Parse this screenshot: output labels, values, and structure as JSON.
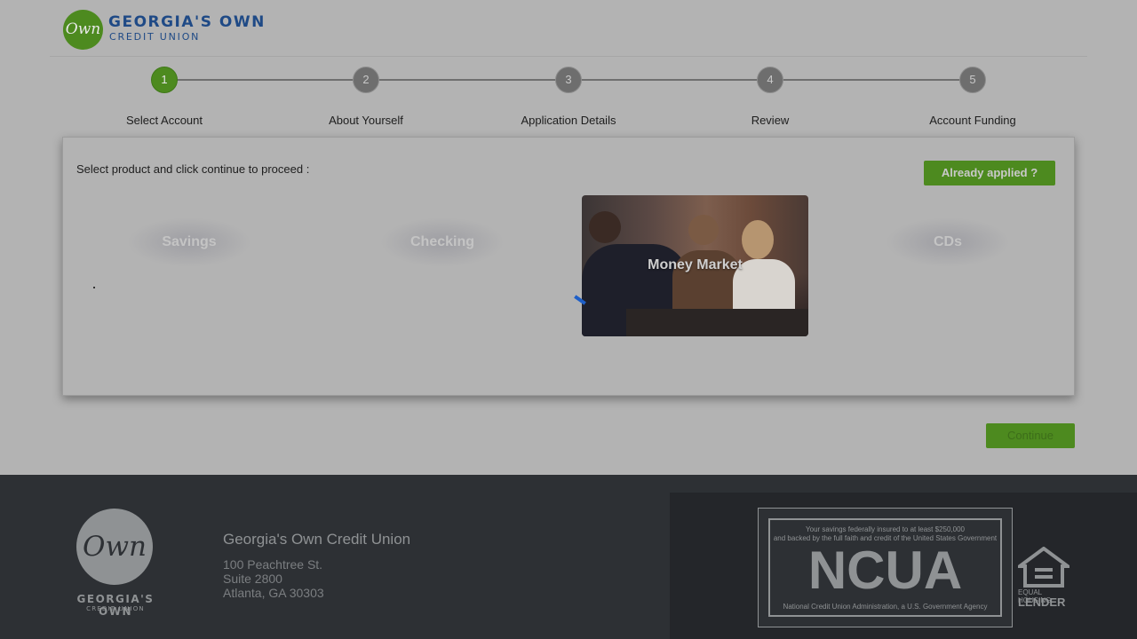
{
  "header": {
    "logo_mark": "Own",
    "logo_name": "GEORGIA'S OWN",
    "logo_sub": "CREDIT UNION"
  },
  "steps": [
    {
      "number": "1",
      "label": "Select Account",
      "active": true
    },
    {
      "number": "2",
      "label": "About Yourself",
      "active": false
    },
    {
      "number": "3",
      "label": "Application Details",
      "active": false
    },
    {
      "number": "4",
      "label": "Review",
      "active": false
    },
    {
      "number": "5",
      "label": "Account Funding",
      "active": false
    }
  ],
  "card": {
    "instruction": "Select product and click continue to proceed :",
    "already_applied": "Already applied ?",
    "products": [
      "Savings",
      "Checking",
      "Money Market",
      "CDs"
    ]
  },
  "continue_label": "Continue",
  "footer": {
    "logo_mark": "Own",
    "logo_name": "GEORGIA'S OWN",
    "logo_sub": "CREDIT UNION",
    "org_name": "Georgia's Own Credit Union",
    "address": [
      "100 Peachtree St.",
      "Suite 2800",
      "Atlanta, GA 30303"
    ],
    "ncua": {
      "line1": "Your savings federally insured to at least $250,000",
      "line2": "and backed by the full faith and credit of the United States Government",
      "big": "NCUA",
      "bottom": "National Credit Union Administration, a U.S. Government Agency"
    },
    "ehl": {
      "line1": "EQUAL HOUSING",
      "line2": "LENDER"
    }
  },
  "colors": {
    "brand_green": "#4d8a1f",
    "brand_blue": "#1f4a86",
    "footer_bg": "#2d3034"
  }
}
